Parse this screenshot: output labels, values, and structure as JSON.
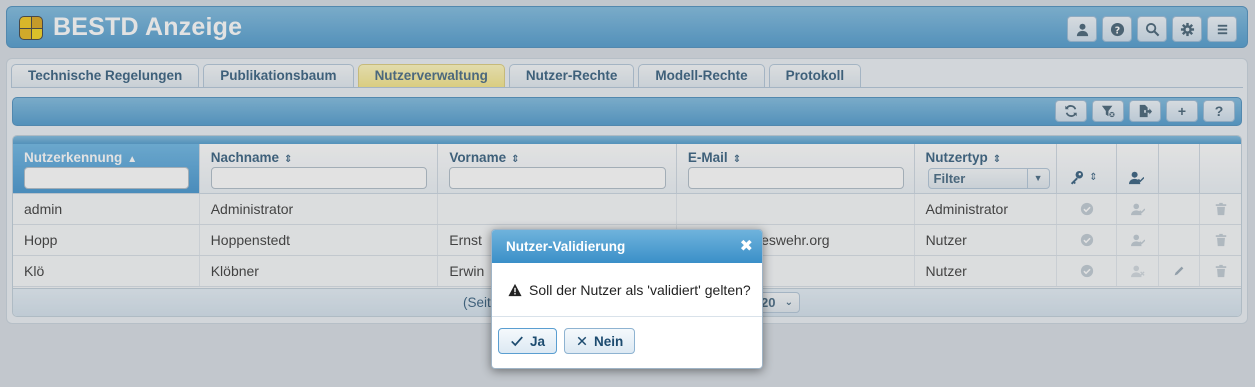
{
  "app": {
    "title": "BESTD Anzeige"
  },
  "header_buttons": [
    {
      "icon": "user-icon"
    },
    {
      "icon": "help-icon"
    },
    {
      "icon": "search-icon"
    },
    {
      "icon": "gear-icon"
    },
    {
      "icon": "menu-icon"
    }
  ],
  "tabs": [
    {
      "label": "Technische Regelungen",
      "active": false
    },
    {
      "label": "Publikationsbaum",
      "active": false
    },
    {
      "label": "Nutzerverwaltung",
      "active": true
    },
    {
      "label": "Nutzer-Rechte",
      "active": false
    },
    {
      "label": "Modell-Rechte",
      "active": false
    },
    {
      "label": "Protokoll",
      "active": false
    }
  ],
  "toolbar": {
    "buttons": [
      {
        "icon": "refresh-icon"
      },
      {
        "icon": "filter-clear-icon"
      },
      {
        "icon": "export-icon"
      },
      {
        "icon": "add-icon",
        "label": "+"
      },
      {
        "icon": "help-icon",
        "label": "?"
      }
    ]
  },
  "table": {
    "columns": {
      "nutzerkennung": "Nutzerkennung",
      "nachname": "Nachname",
      "vorname": "Vorname",
      "email": "E-Mail",
      "nutzertyp": "Nutzertyp"
    },
    "sort_asc": "▲",
    "sort_both": "⇕",
    "nutzertyp_filter": "Filter",
    "rows": [
      {
        "kennung": "admin",
        "nachname": "Administrator",
        "vorname": "",
        "email": "",
        "typ": "Administrator",
        "editable": false
      },
      {
        "kennung": "Hopp",
        "nachname": "Hoppenstedt",
        "vorname": "Ernst",
        "email": "deswehr.org",
        "typ": "Nutzer",
        "editable": false
      },
      {
        "kennung": "Klö",
        "nachname": "Klöbner",
        "vorname": "Erwin",
        "email": "",
        "typ": "Nutzer",
        "editable": true
      }
    ]
  },
  "pager": {
    "text": "(Seit",
    "page_size": "20"
  },
  "dialog": {
    "title": "Nutzer-Validierung",
    "close": "✖",
    "message": "Soll der Nutzer als 'validiert' gelten?",
    "yes_label": "Ja",
    "no_label": "Nein"
  },
  "colors": {
    "header_blue": "#3a8fc8",
    "active_tab": "#f3e27a",
    "text_dark_blue": "#1d4b6f"
  }
}
